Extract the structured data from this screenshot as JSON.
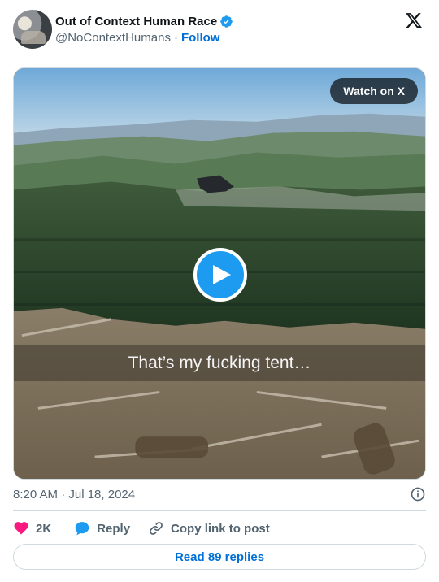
{
  "author": {
    "display_name": "Out of Context Human Race",
    "handle": "@NoContextHumans",
    "separator": "·",
    "follow_label": "Follow",
    "verified": true
  },
  "brand": {
    "logo": "x-logo-icon"
  },
  "media": {
    "watch_label": "Watch on X",
    "caption": "That’s my fucking tent…",
    "play_icon": "play-icon"
  },
  "meta": {
    "timestamp": "8:20 AM · Jul 18, 2024",
    "info_icon": "info-icon"
  },
  "actions": {
    "like_count": "2K",
    "reply_label": "Reply",
    "copy_label": "Copy link to post"
  },
  "footer": {
    "read_replies_label": "Read 89 replies"
  },
  "colors": {
    "accent_blue": "#1d9bf0",
    "link_blue": "#006fd6",
    "like_pink": "#f91880",
    "muted_text": "#536471",
    "border": "#cfd9de"
  }
}
